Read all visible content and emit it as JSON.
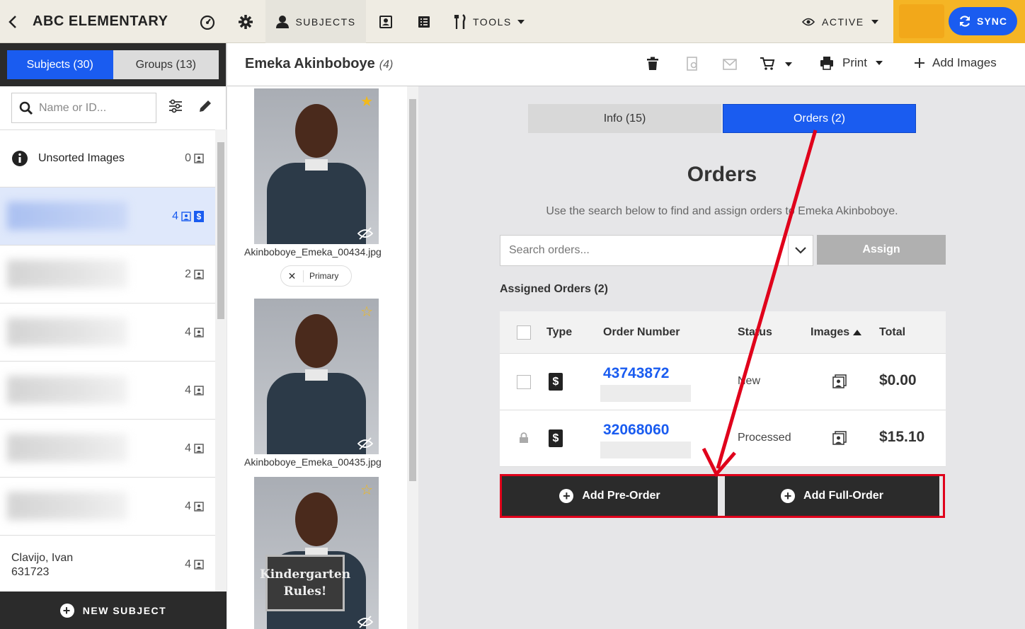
{
  "topbar": {
    "school": "ABC ELEMENTARY",
    "subjects": "SUBJECTS",
    "tools": "TOOLS",
    "active": "ACTIVE",
    "sync": "SYNC"
  },
  "left": {
    "tab_subjects": "Subjects (30)",
    "tab_groups": "Groups (13)",
    "search_placeholder": "Name or ID...",
    "unsorted_label": "Unsorted Images",
    "unsorted_count": "0",
    "items": [
      {
        "count": "4"
      },
      {
        "count": "2"
      },
      {
        "count": "4"
      },
      {
        "count": "4"
      },
      {
        "count": "4"
      },
      {
        "count": "4"
      },
      {
        "name": "Clavijo, Ivan",
        "id": "631723",
        "count": "4"
      }
    ],
    "new_subject": "NEW SUBJECT"
  },
  "header": {
    "subject_name": "Emeka Akinboboye",
    "subject_count": "(4)",
    "print": "Print",
    "add_images": "Add Images"
  },
  "photos": {
    "files": [
      "Akinboboye_Emeka_00434.jpg",
      "Akinboboye_Emeka_00435.jpg"
    ],
    "primary": "Primary",
    "sign_line1": "Kindergarten",
    "sign_line2": "Rules!"
  },
  "main": {
    "tab_info": "Info (15)",
    "tab_orders": "Orders (2)",
    "title": "Orders",
    "help": "Use the search below to find and assign orders to Emeka Akinboboye.",
    "search_placeholder": "Search orders...",
    "assign": "Assign",
    "assigned_label": "Assigned Orders (2)",
    "columns": {
      "type": "Type",
      "number": "Order Number",
      "status": "Status",
      "images": "Images",
      "total": "Total"
    },
    "orders": [
      {
        "number": "43743872",
        "status": "New",
        "total": "$0.00",
        "locked": false
      },
      {
        "number": "32068060",
        "status": "Processed",
        "total": "$15.10",
        "locked": true
      }
    ],
    "add_pre_order": "Add Pre-Order",
    "add_full_order": "Add Full-Order"
  },
  "colors": {
    "accent": "#1a5cf0",
    "highlight": "#e0001b",
    "sync_bg": "#f5b525"
  }
}
